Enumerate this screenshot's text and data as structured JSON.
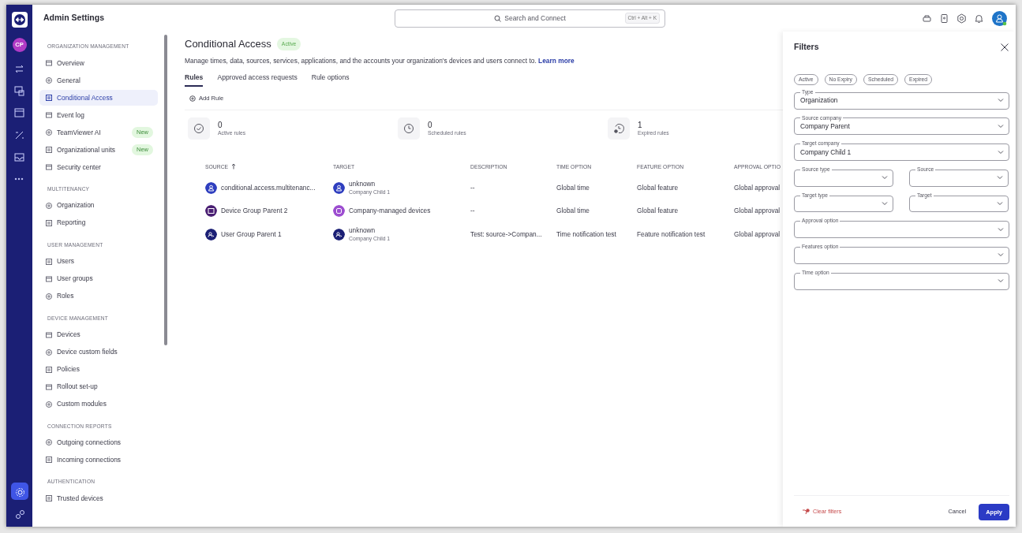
{
  "app_rail": {
    "avatar": "CP",
    "items": [
      {
        "selected": false
      },
      {
        "selected": false
      },
      {
        "selected": false
      },
      {
        "selected": false
      },
      {
        "selected": false
      },
      {
        "selected": false
      }
    ],
    "bottom_items": [
      {
        "selected": true
      },
      {
        "selected": false
      }
    ]
  },
  "header": {
    "title": "Admin Settings",
    "search": {
      "placeholder": "Search and Connect",
      "shortcut": "Ctrl + Alt + K"
    }
  },
  "sidebar": {
    "sections": [
      {
        "heading": "ORGANIZATION MANAGEMENT",
        "items": [
          {
            "label": "Overview",
            "selected": false
          },
          {
            "label": "General",
            "selected": false
          },
          {
            "label": "Conditional Access",
            "selected": true
          },
          {
            "label": "Event log",
            "selected": false
          },
          {
            "label": "TeamViewer AI",
            "selected": false,
            "badge": "New"
          },
          {
            "label": "Organizational units",
            "selected": false,
            "badge": "New"
          },
          {
            "label": "Security center",
            "selected": false
          }
        ]
      },
      {
        "heading": "MULTITENANCY",
        "items": [
          {
            "label": "Organization",
            "selected": false
          },
          {
            "label": "Reporting",
            "selected": false
          }
        ]
      },
      {
        "heading": "USER MANAGEMENT",
        "items": [
          {
            "label": "Users",
            "selected": false
          },
          {
            "label": "User groups",
            "selected": false
          },
          {
            "label": "Roles",
            "selected": false
          }
        ]
      },
      {
        "heading": "DEVICE MANAGEMENT",
        "items": [
          {
            "label": "Devices",
            "selected": false
          },
          {
            "label": "Device custom fields",
            "selected": false
          },
          {
            "label": "Policies",
            "selected": false
          },
          {
            "label": "Rollout set-up",
            "selected": false
          },
          {
            "label": "Custom modules",
            "selected": false
          }
        ]
      },
      {
        "heading": "CONNECTION REPORTS",
        "items": [
          {
            "label": "Outgoing connections",
            "selected": false
          },
          {
            "label": "Incoming connections",
            "selected": false
          }
        ]
      },
      {
        "heading": "AUTHENTICATION",
        "items": [
          {
            "label": "Trusted devices",
            "selected": false
          }
        ]
      }
    ]
  },
  "page": {
    "title": "Conditional Access",
    "status": "Active",
    "description": "Manage times, data, sources, services, applications, and the accounts your organization's devices and users connect to.",
    "link": "Learn more",
    "tabs": [
      {
        "label": "Rules",
        "selected": true
      },
      {
        "label": "Approved access requests",
        "selected": false
      },
      {
        "label": "Rule options",
        "selected": false
      }
    ],
    "add_rule": "Add Rule",
    "stats": [
      {
        "kind": "active",
        "value": "0",
        "label": "Active rules"
      },
      {
        "kind": "scheduled",
        "value": "0",
        "label": "Scheduled rules"
      },
      {
        "kind": "expired",
        "value": "1",
        "label": "Expired rules"
      }
    ],
    "table": {
      "columns": [
        "SOURCE",
        "TARGET",
        "DESCRIPTION",
        "TIME OPTION",
        "FEATURE OPTION",
        "APPROVAL OPTIO"
      ],
      "rows": [
        {
          "source": {
            "kind": "user",
            "name": "conditional.access.multitenanc..."
          },
          "target": {
            "kind": "user",
            "name": "unknown",
            "sub": "Company Child 1"
          },
          "description": "--",
          "time": "Global time",
          "feature": "Global feature",
          "approval": "Global approval"
        },
        {
          "source": {
            "kind": "device-group",
            "name": "Device Group Parent 2"
          },
          "target": {
            "kind": "managed",
            "name": "Company-managed devices"
          },
          "description": "--",
          "time": "Global time",
          "feature": "Global feature",
          "approval": "Global approval"
        },
        {
          "source": {
            "kind": "user-group",
            "name": "User Group Parent 1"
          },
          "target": {
            "kind": "user-group",
            "name": "unknown",
            "sub": "Company Child 1"
          },
          "description": "Test: source->Compan...",
          "time": "Time notification test",
          "feature": "Feature notification test",
          "approval": "Global approval"
        }
      ]
    }
  },
  "filters": {
    "title": "Filters",
    "chips": [
      {
        "label": "Active",
        "selected": false
      },
      {
        "label": "No Expiry",
        "selected": false
      },
      {
        "label": "Scheduled",
        "selected": false
      },
      {
        "label": "Expired",
        "selected": false
      }
    ],
    "fields": [
      {
        "kind": "full",
        "label": "Type",
        "value": "Organization"
      },
      {
        "kind": "full",
        "label": "Source company",
        "value": "Company Parent"
      },
      {
        "kind": "full",
        "label": "Target company",
        "value": "Company Child 1"
      },
      {
        "kind": "half",
        "label": "Source type"
      },
      {
        "kind": "half",
        "label": "Source"
      },
      {
        "kind": "half",
        "label": "Target type"
      },
      {
        "kind": "half",
        "label": "Target"
      },
      {
        "kind": "full",
        "label": "Approval option"
      },
      {
        "kind": "full",
        "label": "Features option"
      },
      {
        "kind": "full",
        "label": "Time option"
      }
    ],
    "clear": "Clear filters",
    "cancel": "Cancel",
    "apply": "Apply"
  }
}
